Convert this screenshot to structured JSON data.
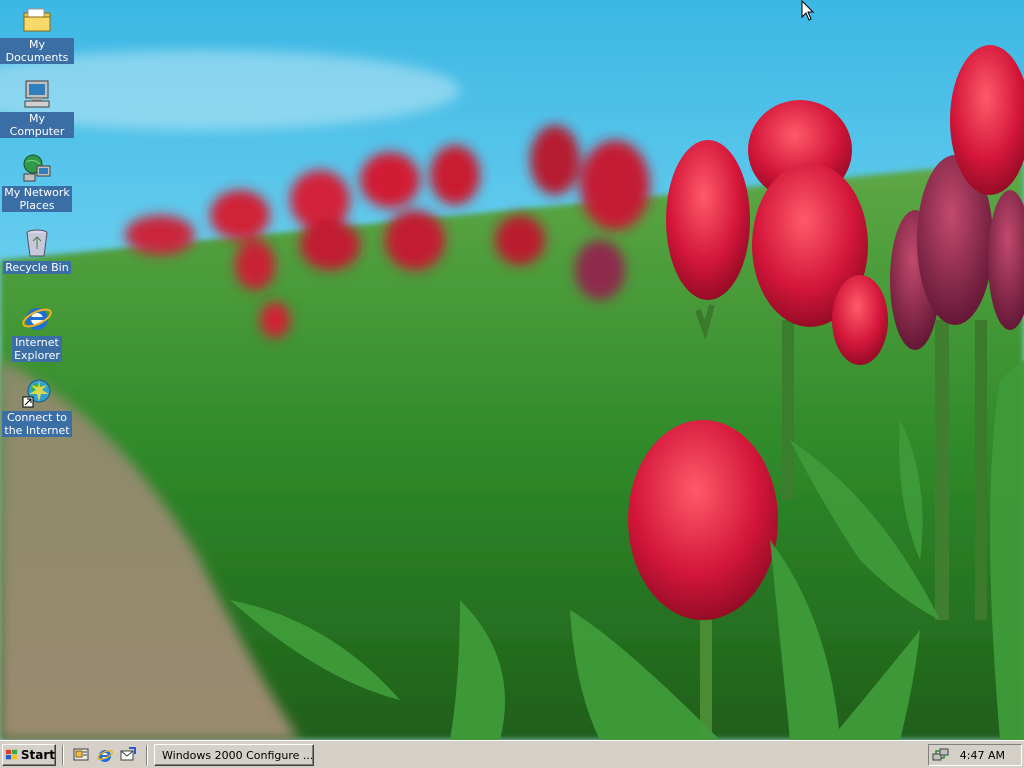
{
  "desktop": {
    "icons": [
      {
        "label": "My Documents",
        "icon": "folder-icon"
      },
      {
        "label": "My Computer",
        "icon": "computer-icon"
      },
      {
        "label": "My Network\nPlaces",
        "icon": "network-places-icon"
      },
      {
        "label": "Recycle Bin",
        "icon": "recycle-bin-icon"
      },
      {
        "label": "Internet\nExplorer",
        "icon": "internet-explorer-icon"
      },
      {
        "label": "Connect to\nthe Internet",
        "icon": "connect-internet-icon"
      }
    ],
    "wallpaper": "red-tulips-photo",
    "label_bg_color": "#3a6ea5"
  },
  "taskbar": {
    "start_label": "Start",
    "quick_launch": [
      "show-desktop-icon",
      "internet-explorer-icon",
      "outlook-express-icon"
    ],
    "tasks": [
      {
        "label": "Windows 2000 Configure ...",
        "icon": "configure-window-icon"
      }
    ],
    "tray": {
      "icons": [
        "network-connection-icon"
      ],
      "clock": "4:47 AM"
    },
    "bg_color": "#d4d0c8"
  }
}
